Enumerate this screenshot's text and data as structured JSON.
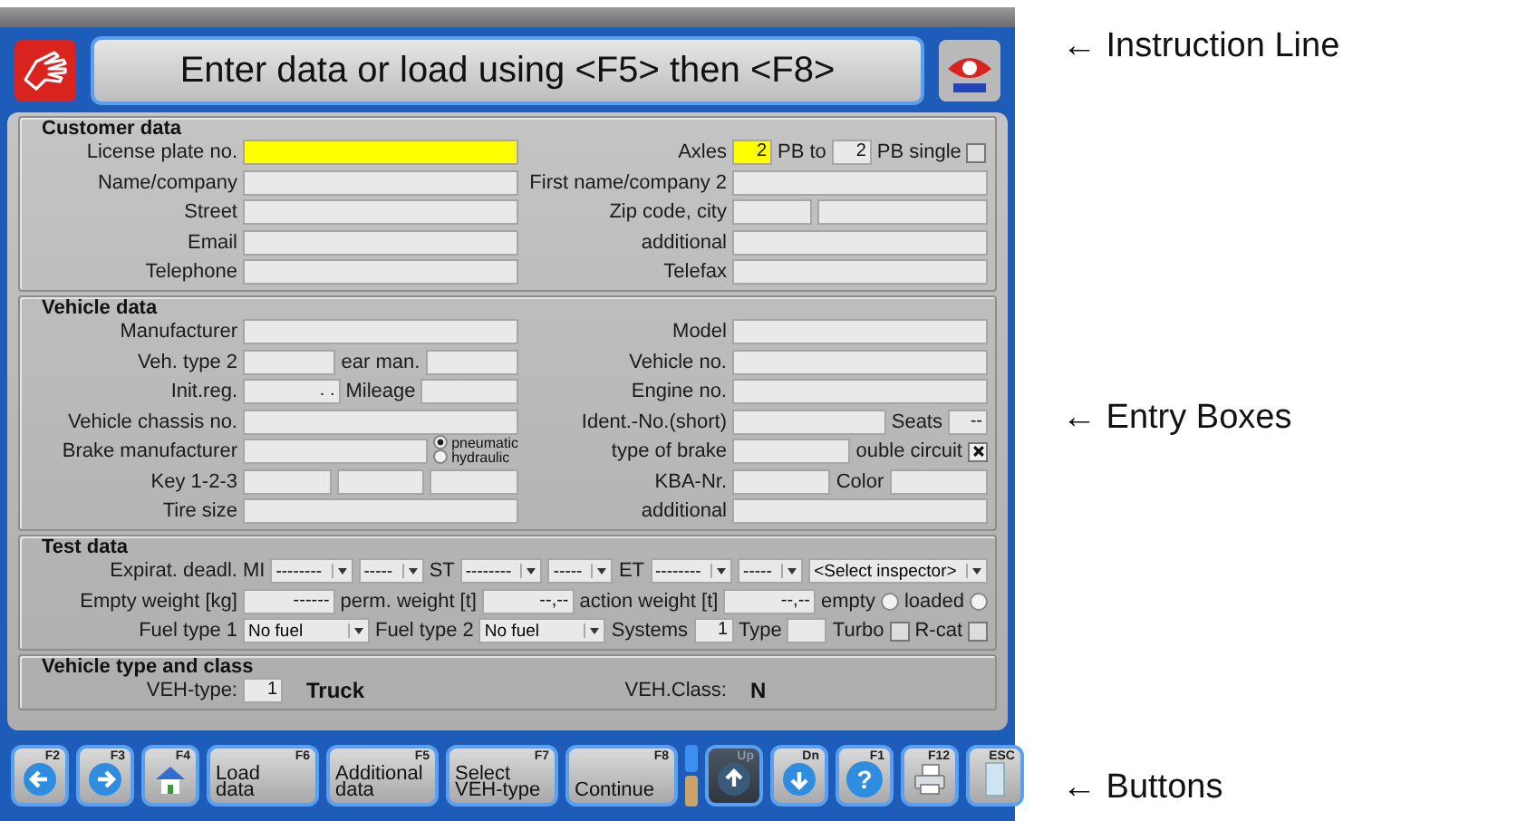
{
  "instruction": "Enter data or load using <F5> then <F8>",
  "sections": [
    {
      "title": "Customer data",
      "rows": [
        {
          "left": {
            "label": "License plate no.",
            "controls": [
              {
                "kind": "field",
                "highlighted": true
              }
            ]
          },
          "right": {
            "label": "Axles",
            "controls": [
              {
                "kind": "field",
                "value": "2",
                "highlighted": true
              },
              {
                "kind": "label",
                "text": "PB to"
              },
              {
                "kind": "field",
                "value": "2",
                "highlighted": false
              },
              {
                "kind": "label",
                "text": "PB single"
              },
              {
                "kind": "check",
                "checked": false
              }
            ]
          }
        },
        {
          "left": {
            "label": "Name/company",
            "controls": [
              {
                "kind": "field",
                "highlighted": false
              }
            ]
          },
          "right": {
            "label": "First name/company 2",
            "controls": [
              {
                "kind": "field",
                "highlighted": false
              }
            ]
          }
        },
        {
          "left": {
            "label": "Street",
            "controls": [
              {
                "kind": "field",
                "highlighted": false
              }
            ]
          },
          "right": {
            "label": "Zip code, city",
            "controls": [
              {
                "kind": "field",
                "highlighted": false
              },
              {
                "kind": "field",
                "highlighted": false
              }
            ]
          }
        },
        {
          "left": {
            "label": "Email",
            "controls": [
              {
                "kind": "field",
                "highlighted": false
              }
            ]
          },
          "right": {
            "label": "additional",
            "controls": [
              {
                "kind": "field",
                "highlighted": false
              }
            ]
          }
        },
        {
          "left": {
            "label": "Telephone",
            "controls": [
              {
                "kind": "field",
                "highlighted": false
              }
            ]
          },
          "right": {
            "label": "Telefax",
            "controls": [
              {
                "kind": "field",
                "highlighted": false
              }
            ]
          }
        }
      ]
    },
    {
      "title": "Vehicle data",
      "rows": [
        {
          "left": {
            "label": "Manufacturer",
            "controls": [
              {
                "kind": "field",
                "highlighted": false
              }
            ]
          },
          "right": {
            "label": "Model",
            "controls": [
              {
                "kind": "field",
                "highlighted": false
              }
            ]
          }
        },
        {
          "left": {
            "label": "Veh. type 2",
            "controls": [
              {
                "kind": "field",
                "highlighted": false
              },
              {
                "kind": "label",
                "text": "ear man."
              },
              {
                "kind": "field",
                "highlighted": false
              }
            ]
          },
          "right": {
            "label": "Vehicle no.",
            "controls": [
              {
                "kind": "field",
                "highlighted": false
              }
            ]
          }
        },
        {
          "left": {
            "label": "Init.reg.",
            "controls": [
              {
                "kind": "field",
                "value": ". .",
                "highlighted": false
              },
              {
                "kind": "label",
                "text": "Mileage"
              },
              {
                "kind": "field",
                "highlighted": false
              }
            ]
          },
          "right": {
            "label": "Engine no.",
            "controls": [
              {
                "kind": "field",
                "highlighted": false
              }
            ]
          }
        },
        {
          "left": {
            "label": "Vehicle chassis no.",
            "controls": [
              {
                "kind": "field",
                "highlighted": false
              }
            ]
          },
          "right": {
            "label": "Ident.-No.(short)",
            "controls": [
              {
                "kind": "field",
                "highlighted": false
              },
              {
                "kind": "label",
                "text": "Seats"
              },
              {
                "kind": "field",
                "value": "--",
                "highlighted": false
              }
            ]
          }
        },
        {
          "left": {
            "label": "Brake manufacturer",
            "controls": [
              {
                "kind": "field",
                "highlighted": false
              },
              {
                "kind": "radios",
                "options": [
                  {
                    "label": "pneumatic",
                    "selected": true
                  },
                  {
                    "label": "hydraulic",
                    "selected": false
                  }
                ]
              }
            ]
          },
          "right": {
            "label": "type of brake",
            "controls": [
              {
                "kind": "field",
                "highlighted": false
              },
              {
                "kind": "label",
                "text": "ouble circuit"
              },
              {
                "kind": "check",
                "checked": true
              }
            ]
          }
        },
        {
          "left": {
            "label": "Key 1-2-3",
            "controls": [
              {
                "kind": "field",
                "highlighted": false
              },
              {
                "kind": "field",
                "highlighted": false
              },
              {
                "kind": "field",
                "highlighted": false
              }
            ]
          },
          "right": {
            "label": "KBA-Nr.",
            "controls": [
              {
                "kind": "field",
                "highlighted": false
              },
              {
                "kind": "label",
                "text": "Color"
              },
              {
                "kind": "field",
                "highlighted": false
              }
            ]
          }
        },
        {
          "left": {
            "label": "Tire size",
            "controls": [
              {
                "kind": "field",
                "highlighted": false
              }
            ]
          },
          "right": {
            "label": "additional",
            "controls": [
              {
                "kind": "field",
                "highlighted": false
              }
            ]
          }
        }
      ]
    },
    {
      "title": "Test data",
      "rows": [
        {
          "label": "Expirat. deadl.",
          "controls": [
            {
              "kind": "label",
              "text": "MI"
            },
            {
              "kind": "select",
              "value": "--------"
            },
            {
              "kind": "select",
              "value": "-----"
            },
            {
              "kind": "label",
              "text": "ST"
            },
            {
              "kind": "select",
              "value": "--------"
            },
            {
              "kind": "select",
              "value": "-----"
            },
            {
              "kind": "label",
              "text": "ET"
            },
            {
              "kind": "select",
              "value": "--------"
            },
            {
              "kind": "select",
              "value": "-----"
            },
            {
              "kind": "select",
              "value": "<Select inspector>"
            }
          ]
        },
        {
          "label": "Empty weight [kg]",
          "controls": [
            {
              "kind": "field",
              "value": "------",
              "highlighted": false
            },
            {
              "kind": "label",
              "text": "perm. weight [t]"
            },
            {
              "kind": "field",
              "value": "--,--",
              "highlighted": false
            },
            {
              "kind": "label",
              "text": "action weight [t]"
            },
            {
              "kind": "field",
              "value": "--,--",
              "highlighted": false
            },
            {
              "kind": "label",
              "text": "empty"
            },
            {
              "kind": "radio",
              "selected": false
            },
            {
              "kind": "label",
              "text": "loaded"
            },
            {
              "kind": "radio",
              "selected": false
            }
          ]
        },
        {
          "label": "Fuel type 1",
          "controls": [
            {
              "kind": "select",
              "value": "No fuel"
            },
            {
              "kind": "label",
              "text": "Fuel type 2"
            },
            {
              "kind": "select",
              "value": "No fuel"
            },
            {
              "kind": "label",
              "text": "Systems"
            },
            {
              "kind": "field",
              "value": "1",
              "highlighted": false
            },
            {
              "kind": "label",
              "text": "Type"
            },
            {
              "kind": "field",
              "highlighted": false
            },
            {
              "kind": "label",
              "text": "Turbo"
            },
            {
              "kind": "check",
              "checked": false
            },
            {
              "kind": "label",
              "text": "R-cat"
            },
            {
              "kind": "check",
              "checked": false
            }
          ]
        }
      ]
    },
    {
      "title": "Vehicle type and class",
      "rows": [
        {
          "left": {
            "label": "VEH-type:",
            "controls": [
              {
                "kind": "field",
                "value": "1",
                "highlighted": false
              },
              {
                "kind": "value",
                "text": "Truck"
              }
            ]
          },
          "right": {
            "label": "VEH.Class:",
            "controls": [
              {
                "kind": "value",
                "text": "N"
              }
            ]
          }
        }
      ]
    }
  ],
  "buttons": [
    {
      "key": "F2",
      "kind": "back",
      "disabled": false
    },
    {
      "key": "F3",
      "kind": "forward",
      "disabled": false
    },
    {
      "key": "F4",
      "kind": "home",
      "disabled": false
    },
    {
      "key": "F6",
      "kind": "text",
      "label": "Load\ndata",
      "disabled": false
    },
    {
      "key": "F5",
      "kind": "text",
      "label": "Additional\ndata",
      "disabled": false
    },
    {
      "key": "F7",
      "kind": "text",
      "label": "Select\nVEH-type",
      "disabled": false
    },
    {
      "key": "F8",
      "kind": "text",
      "label": "Continue",
      "disabled": false
    },
    {
      "kind": "scroll"
    },
    {
      "key": "Up",
      "kind": "up",
      "disabled": true
    },
    {
      "key": "Dn",
      "kind": "down",
      "disabled": false
    },
    {
      "key": "F1",
      "kind": "help",
      "glyph": "?",
      "disabled": false
    },
    {
      "key": "F12",
      "kind": "print",
      "disabled": false
    },
    {
      "key": "ESC",
      "kind": "exit",
      "disabled": false
    }
  ],
  "annotations": [
    "← Instruction Line",
    "← Entry Boxes",
    "← Buttons"
  ]
}
